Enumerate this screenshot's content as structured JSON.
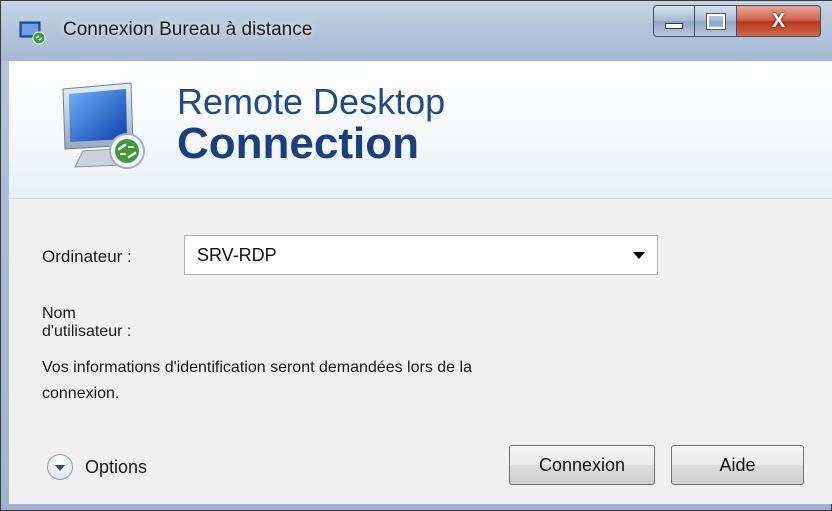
{
  "window": {
    "title": "Connexion Bureau à distance",
    "close_glyph": "X"
  },
  "banner": {
    "line1": "Remote Desktop",
    "line2": "Connection",
    "icon": "remote-desktop-monitor-icon"
  },
  "form": {
    "computer_label": "Ordinateur :",
    "computer_value": "SRV-RDP",
    "username_label_line1": "Nom",
    "username_label_line2": "d'utilisateur :",
    "info_line1": "Vos informations d'identification seront demandées lors de la",
    "info_line2": "connexion."
  },
  "footer": {
    "options_label": "Options",
    "connect_label": "Connexion",
    "help_label": "Aide"
  },
  "colors": {
    "brand_blue": "#1e4a92",
    "close_red": "#c8442c"
  }
}
